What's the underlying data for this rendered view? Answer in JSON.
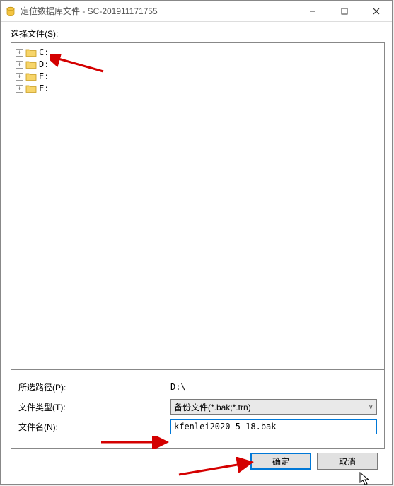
{
  "titlebar": {
    "title": "定位数据库文件 - SC-201911171755"
  },
  "labels": {
    "select_files": "选择文件(S):",
    "selected_path": "所选路径(P):",
    "file_type": "文件类型(T):",
    "file_name": "文件名(N):"
  },
  "drives": [
    {
      "label": "C:"
    },
    {
      "label": "D:"
    },
    {
      "label": "E:"
    },
    {
      "label": "F:"
    }
  ],
  "path_value": "D:\\",
  "file_type_value": "备份文件(*.bak;*.trn)",
  "file_name_value": "kfenlei2020-5-18.bak",
  "buttons": {
    "ok": "确定",
    "cancel": "取消"
  }
}
